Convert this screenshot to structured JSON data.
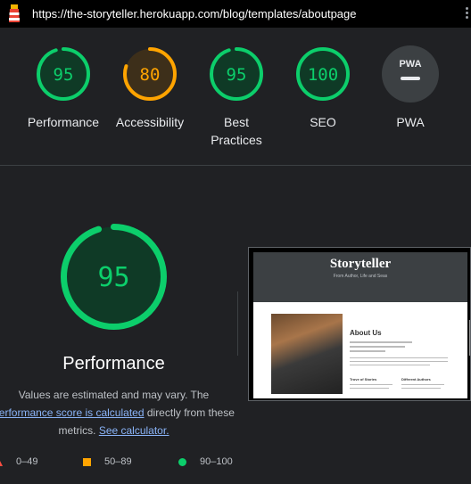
{
  "browser": {
    "url": "https://the-storyteller.herokuapp.com/blog/templates/aboutpage"
  },
  "colors": {
    "pass": "#0cce6b",
    "average": "#ffa400",
    "fail": "#ff4e42",
    "pwa": "#e8eaed"
  },
  "summary": {
    "performance": {
      "score": "95",
      "label": "Performance"
    },
    "accessibility": {
      "score": "80",
      "label": "Accessibility"
    },
    "best_practices": {
      "score": "95",
      "label": "Best Practices"
    },
    "seo": {
      "score": "100",
      "label": "SEO"
    },
    "pwa": {
      "badge": "PWA",
      "label": "PWA"
    }
  },
  "detail": {
    "score": "95",
    "title": "Performance",
    "desc_1": "Values are estimated and may vary. The",
    "desc_link_1": "performance score is calculated",
    "desc_2": " directly from these metrics. ",
    "desc_link_2": "See calculator.",
    "legend": {
      "fail": "0–49",
      "average": "50–89",
      "pass": "90–100"
    }
  },
  "screenshot": {
    "brand": "Storyteller",
    "tagline": "From Author, Life and Seas",
    "heading": "About Us",
    "sub_1": "Trove of Stories",
    "sub_2": "Different Authors"
  }
}
